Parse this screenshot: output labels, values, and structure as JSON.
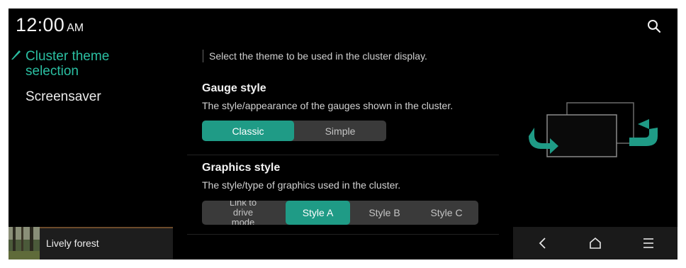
{
  "status_bar": {
    "time": "12:00",
    "ampm": "AM"
  },
  "sidebar": {
    "items": [
      {
        "label": "Cluster theme selection",
        "active": true
      },
      {
        "label": "Screensaver",
        "active": false
      }
    ]
  },
  "main": {
    "hint": "Select the theme to be used in the cluster display.",
    "gauge_style": {
      "title": "Gauge style",
      "description": "The style/appearance of the gauges shown in the cluster.",
      "options": [
        "Classic",
        "Simple"
      ],
      "selected": "Classic"
    },
    "graphics_style": {
      "title": "Graphics style",
      "description": "The style/type of graphics used in the cluster.",
      "options": [
        "Link to drive mode",
        "Style A",
        "Style B",
        "Style C"
      ],
      "selected": "Style A"
    }
  },
  "media": {
    "title": "Lively forest"
  },
  "icons": [
    "search-icon",
    "back-icon",
    "home-icon",
    "menu-icon"
  ],
  "colors": {
    "accent": "#2bbfa2",
    "selected_bg": "#1f9b86",
    "background": "#000000"
  }
}
